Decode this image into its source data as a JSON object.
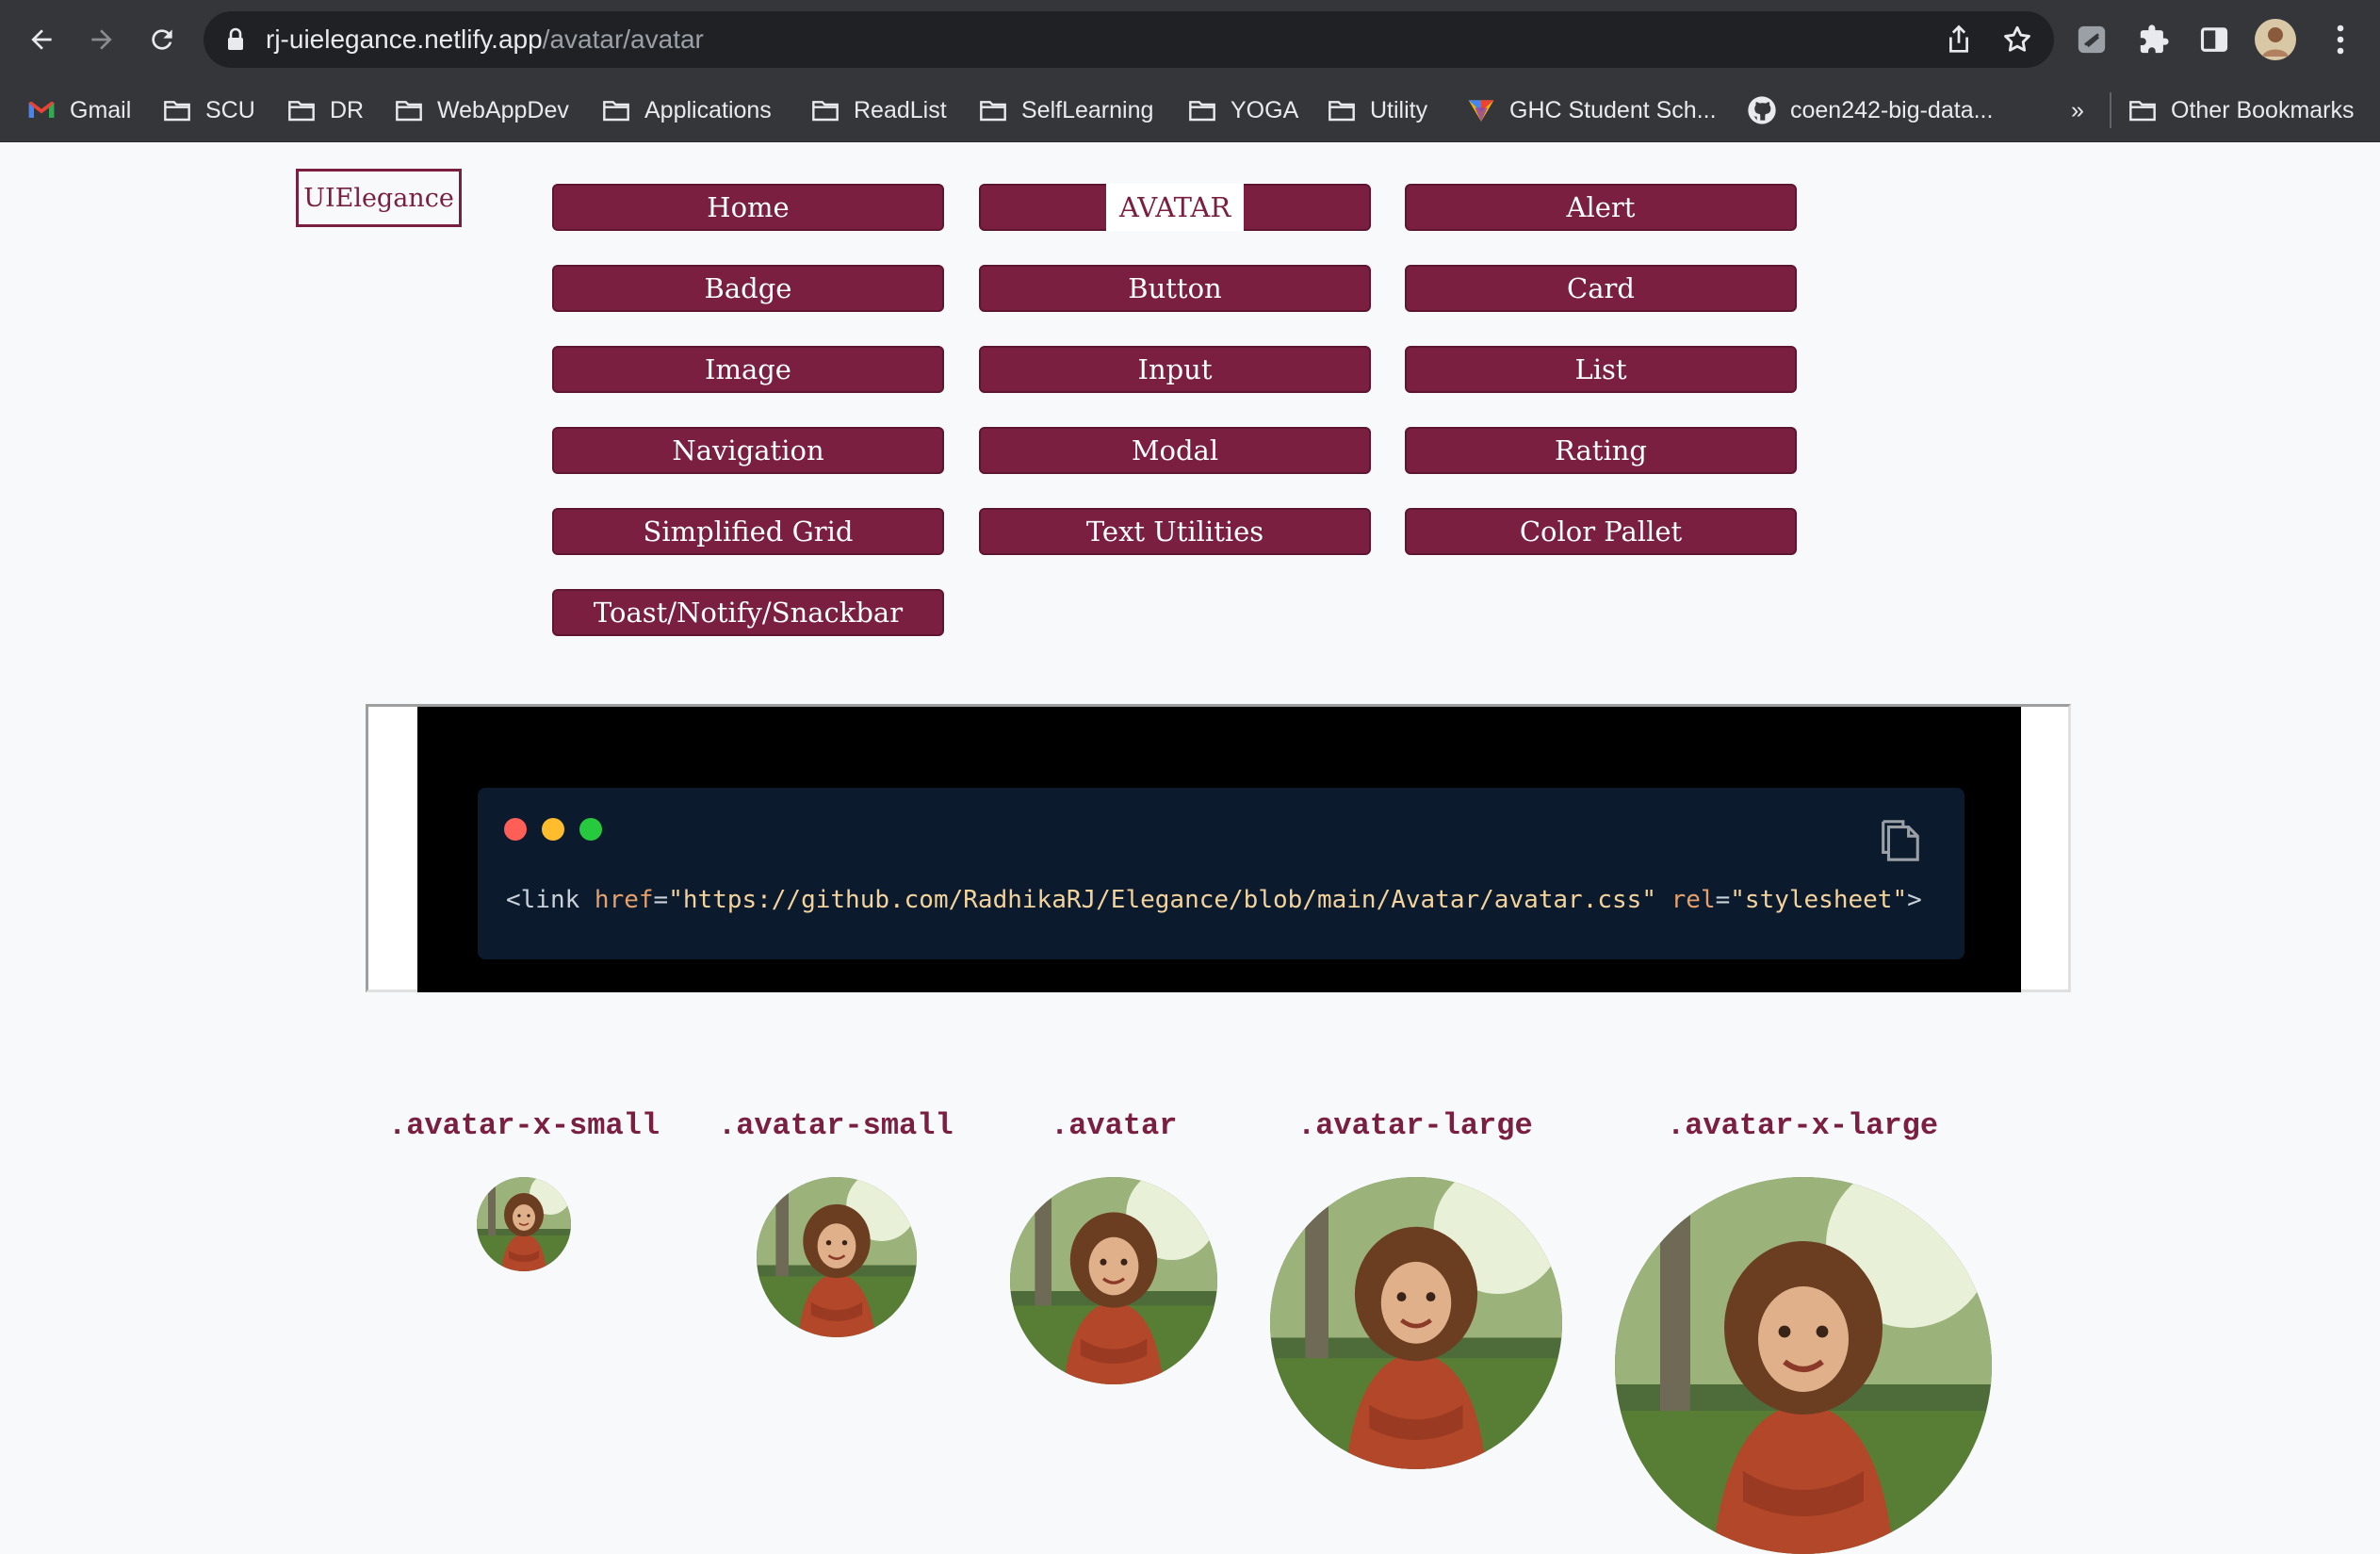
{
  "browser": {
    "url_host": "rj-uielegance.netlify.app",
    "url_path": "/avatar/avatar",
    "overflow_chevron": "»",
    "bookmarks": [
      {
        "label": "Gmail",
        "icon": "gmail-icon"
      },
      {
        "label": "SCU",
        "icon": "folder-icon"
      },
      {
        "label": "DR",
        "icon": "folder-icon"
      },
      {
        "label": "WebAppDev",
        "icon": "folder-icon"
      },
      {
        "label": "Applications",
        "icon": "folder-icon"
      },
      {
        "label": "ReadList",
        "icon": "folder-icon"
      },
      {
        "label": "SelfLearning",
        "icon": "folder-icon"
      },
      {
        "label": "YOGA",
        "icon": "folder-icon"
      },
      {
        "label": "Utility",
        "icon": "folder-icon"
      },
      {
        "label": "GHC Student Sch...",
        "icon": "ghc-icon"
      },
      {
        "label": "coen242-big-data...",
        "icon": "github-icon"
      },
      {
        "label": "Other Bookmarks",
        "icon": "folder-icon"
      }
    ]
  },
  "site": {
    "logo": "UIElegance",
    "nav": [
      "Home",
      "AVATAR",
      "Alert",
      "Badge",
      "Button",
      "Card",
      "Image",
      "Input",
      "List",
      "Navigation",
      "Modal",
      "Rating",
      "Simplified Grid",
      "Text Utilities",
      "Color Pallet",
      "Toast/Notify/Snackbar"
    ],
    "active_nav": "AVATAR"
  },
  "code": {
    "tag_open": "<link ",
    "attr1": "href",
    "eq1": "=",
    "val1": "\"https://github.com/RadhikaRJ/Elegance/blob/main/Avatar/avatar.css\"",
    "attr2": "rel",
    "eq2": "=",
    "val2": "\"stylesheet\"",
    "tag_close": ">"
  },
  "avatars": [
    {
      "label": ".avatar-x-small"
    },
    {
      "label": ".avatar-small"
    },
    {
      "label": ".avatar"
    },
    {
      "label": ".avatar-large"
    },
    {
      "label": ".avatar-x-large"
    }
  ],
  "colors": {
    "brand": "#7a1f3f",
    "chrome": "#35363a",
    "code_bg": "#0b1a2d"
  }
}
